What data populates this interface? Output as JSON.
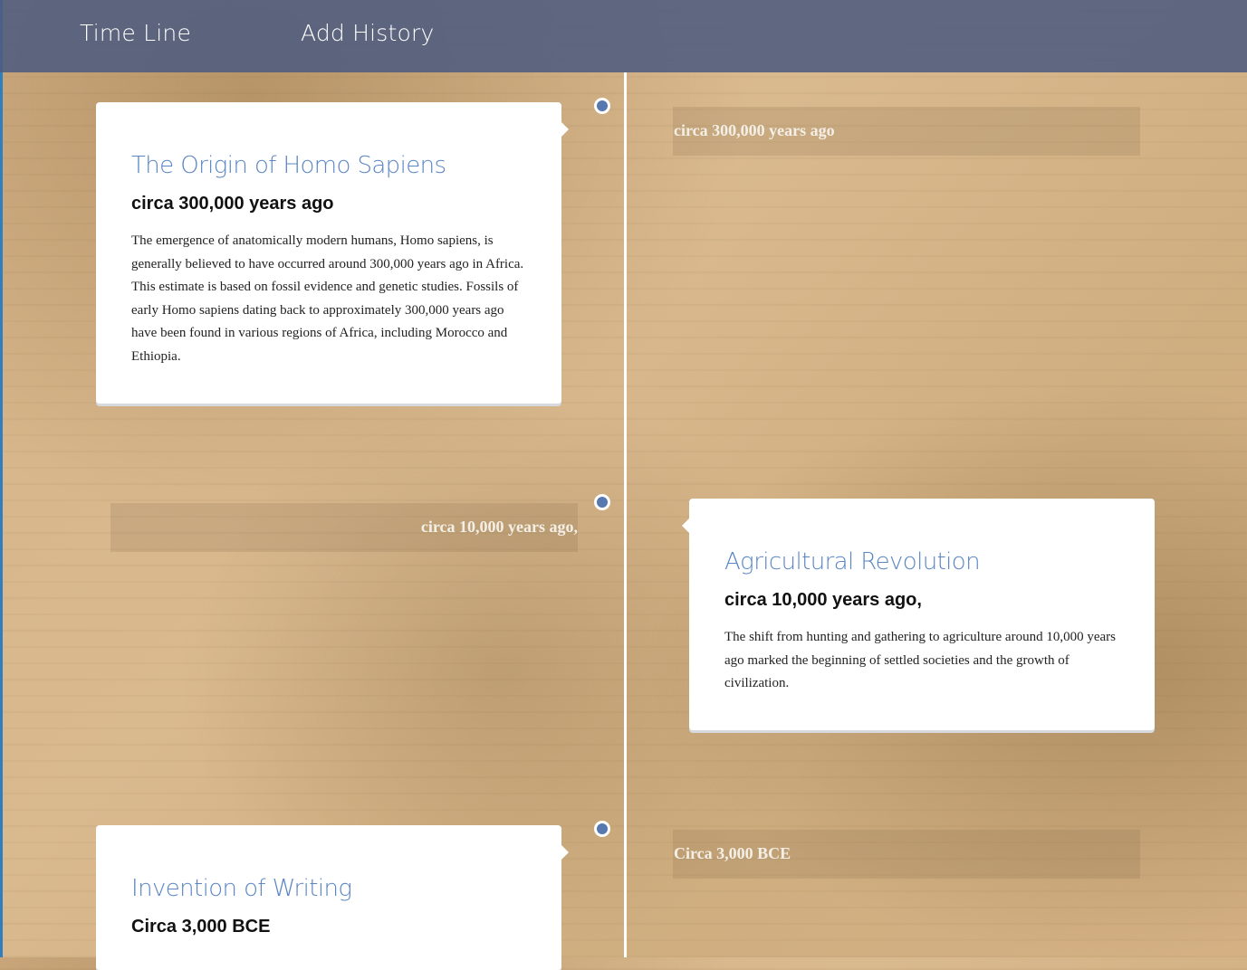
{
  "nav": {
    "items": [
      {
        "label": "Time Line"
      },
      {
        "label": "Add History"
      }
    ]
  },
  "events": [
    {
      "title": "The Origin of Homo Sapiens",
      "date": "circa 300,000 years ago",
      "description": "The emergence of anatomically modern humans, Homo sapiens, is generally believed to have occurred around 300,000 years ago in Africa. This estimate is based on fossil evidence and genetic studies. Fossils of early Homo sapiens dating back to approximately 300,000 years ago have been found in various regions of Africa, including Morocco and Ethiopia.",
      "side": "left"
    },
    {
      "title": "Agricultural Revolution",
      "date": "circa 10,000 years ago,",
      "description": "The shift from hunting and gathering to agriculture around 10,000 years ago marked the beginning of settled societies and the growth of civilization.",
      "side": "right"
    },
    {
      "title": "Invention of Writing",
      "date": "Circa 3,000 BCE",
      "description": "",
      "side": "left"
    }
  ],
  "colors": {
    "navbar": "#4e5c80",
    "accent": "#5a86c5",
    "dot": "#5878b0",
    "timeline_line": "#ffffff"
  }
}
